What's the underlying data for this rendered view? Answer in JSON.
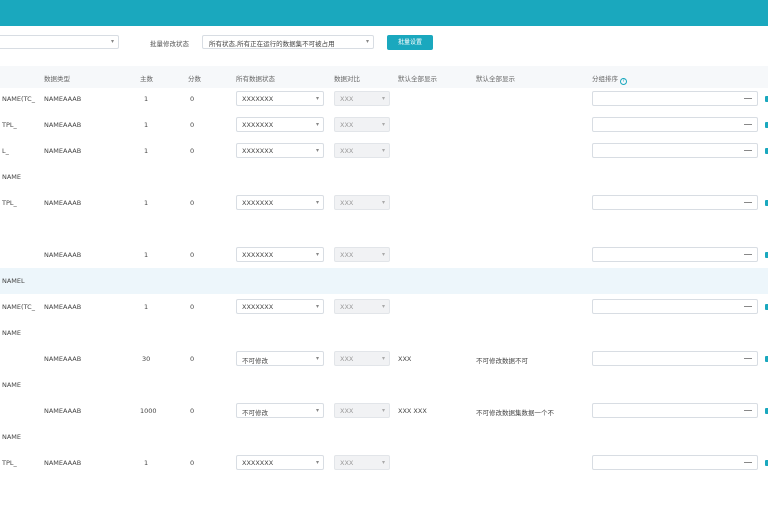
{
  "toolbar": {
    "left_select_value": "",
    "label": "批量修改状态",
    "mid_select_value": "所有状态,所有正在运行的数据集不可被占用",
    "button_label": "批量设置"
  },
  "columns": [
    {
      "label": "数据类型"
    },
    {
      "label": "主数"
    },
    {
      "label": "分数"
    },
    {
      "label": "所有数据状态"
    },
    {
      "label": "数据对比"
    },
    {
      "label": "默认全部显示"
    },
    {
      "label": "默认全部显示"
    },
    {
      "label": "分组排序"
    }
  ],
  "help_icon": "question-circle-icon",
  "rows": [
    {
      "name": "NAME(TC_",
      "type": "NAMEAAAB",
      "main": "1",
      "sub": "0",
      "status": "XXXXXXX",
      "compare": "XXX",
      "d1": "",
      "d2": ""
    },
    {
      "name": "TPL_",
      "type": "NAMEAAAB",
      "main": "1",
      "sub": "0",
      "status": "XXXXXXX",
      "compare": "XXX",
      "d1": "",
      "d2": ""
    },
    {
      "name": "L_",
      "type": "NAMEAAAB",
      "main": "1",
      "sub": "0",
      "status": "XXXXXXX",
      "compare": "XXX",
      "d1": "",
      "d2": ""
    },
    {
      "name": "TPL_",
      "type": "NAMEAAAB",
      "main": "1",
      "sub": "0",
      "status": "XXXXXXX",
      "compare": "XXX",
      "d1": "",
      "d2": ""
    },
    {
      "name": "",
      "type": "NAMEAAAB",
      "main": "1",
      "sub": "0",
      "status": "XXXXXXX",
      "compare": "XXX",
      "d1": "",
      "d2": ""
    },
    {
      "name": "NAME(TC_",
      "type": "NAMEAAAB",
      "main": "1",
      "sub": "0",
      "status": "XXXXXXX",
      "compare": "XXX",
      "d1": "",
      "d2": ""
    },
    {
      "name": "",
      "type": "NAMEAAAB",
      "main": "30",
      "sub": "0",
      "status": "不可修改",
      "compare": "XXX",
      "d1": "XXX",
      "d2": "不可修改数据不可"
    },
    {
      "name": "",
      "type": "NAMEAAAB",
      "main": "1000",
      "sub": "0",
      "status": "不可修改",
      "compare": "XXX",
      "d1": "XXX XXX",
      "d2": "不可修改数据集数据一个不"
    },
    {
      "name": "TPL_",
      "type": "NAMEAAAB",
      "main": "1",
      "sub": "0",
      "status": "XXXXXXX",
      "compare": "XXX",
      "d1": "",
      "d2": ""
    }
  ],
  "groups": [
    {
      "label": "NAME"
    },
    {
      "label": ""
    },
    {
      "label": "NAMEL"
    },
    {
      "label": "NAME"
    },
    {
      "label": "NAME"
    },
    {
      "label": "NAME"
    }
  ]
}
